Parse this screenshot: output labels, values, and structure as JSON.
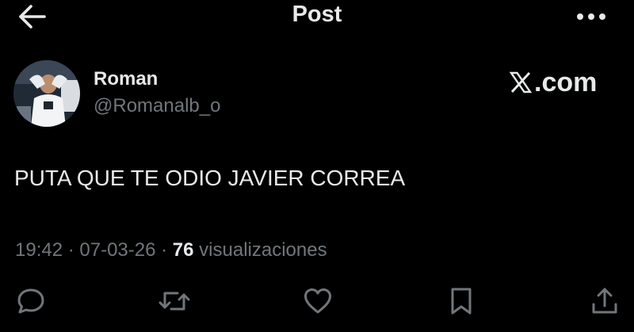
{
  "header": {
    "title": "Post",
    "back_icon": "arrow-left-icon",
    "more_icon": "more-horizontal-icon"
  },
  "author": {
    "display_name": "Roman",
    "handle": "@Romanalb_o",
    "avatar_icon": "avatar-photo"
  },
  "watermark": {
    "text": ".com",
    "icon": "x-logo-icon"
  },
  "post": {
    "text": "PUTA QUE TE ODIO JAVIER CORREA"
  },
  "meta": {
    "time": "19:42",
    "separator": " · ",
    "date": "07-03-26",
    "views_count": "76",
    "views_label": "visualizaciones"
  },
  "actions": [
    {
      "name": "reply",
      "icon": "reply-icon"
    },
    {
      "name": "repost",
      "icon": "repost-icon"
    },
    {
      "name": "like",
      "icon": "heart-icon"
    },
    {
      "name": "bookmark",
      "icon": "bookmark-icon"
    },
    {
      "name": "share",
      "icon": "share-icon"
    }
  ],
  "colors": {
    "background": "#000000",
    "text_primary": "#e7e9ea",
    "text_secondary": "#71767b"
  }
}
